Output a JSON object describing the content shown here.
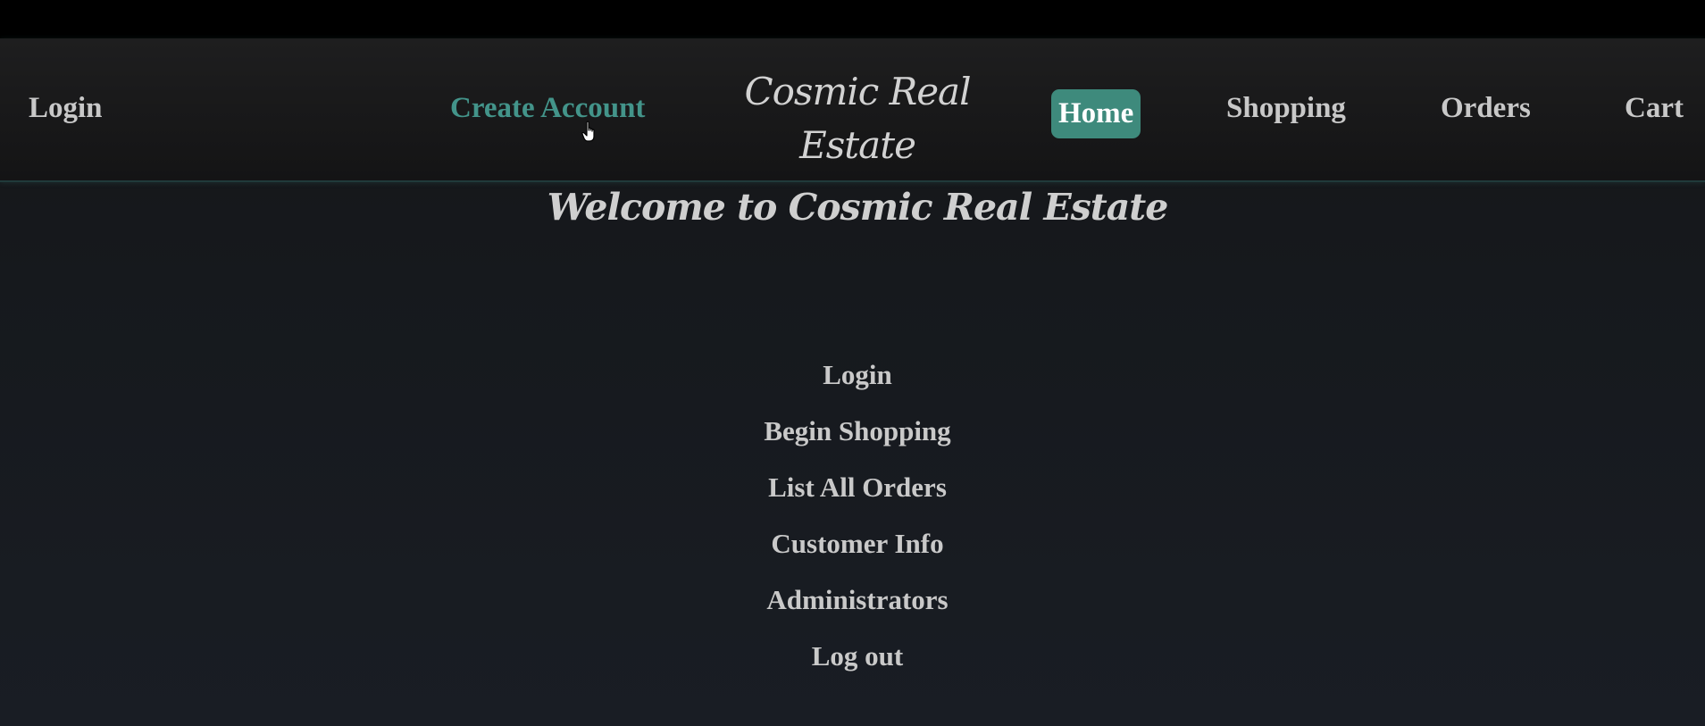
{
  "navbar": {
    "login": "Login",
    "create_account": "Create Account",
    "brand_line1": "Cosmic Real",
    "brand_line2": "Estate",
    "home": "Home",
    "shopping": "Shopping",
    "orders": "Orders",
    "cart": "Cart"
  },
  "main": {
    "welcome": "Welcome to Cosmic Real Estate",
    "menu": [
      "Login",
      "Begin Shopping",
      "List All Orders",
      "Customer Info",
      "Administrators",
      "Log out"
    ]
  },
  "colors": {
    "accent": "#3e8a7c",
    "hover_link": "#43948a",
    "text": "#c8c8c8",
    "background": "#16191d"
  },
  "icons": {
    "cursor": "hand-pointer-icon"
  }
}
